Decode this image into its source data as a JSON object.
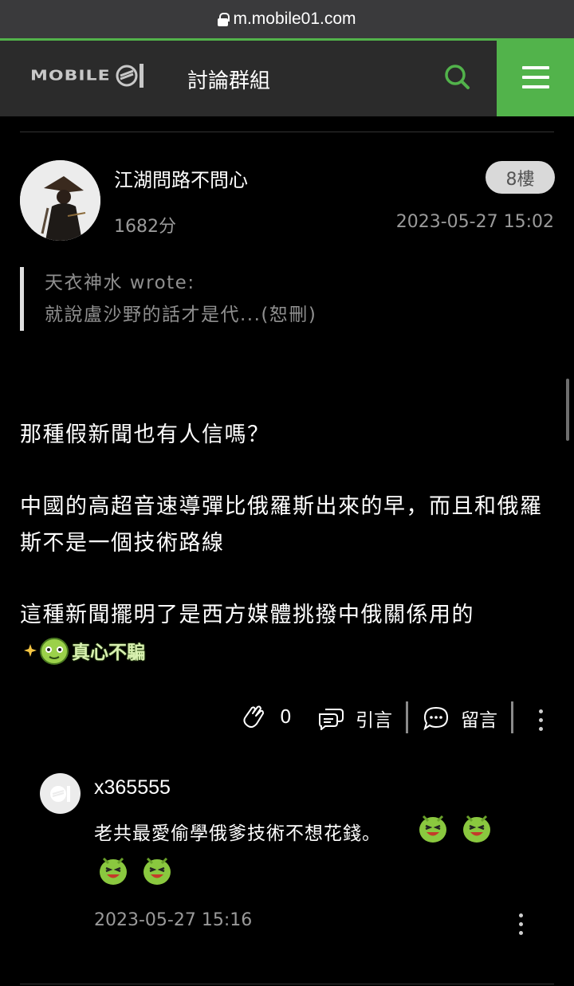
{
  "browser": {
    "url": "m.mobile01.com"
  },
  "header": {
    "logo_text": "MOBILE",
    "logo_suffix": "01",
    "section_title": "討論群組"
  },
  "post": {
    "author": "江湖問路不問心",
    "score": "1682分",
    "floor": "8樓",
    "time": "2023-05-27 15:02",
    "quote": {
      "line1": "天衣神水 wrote:",
      "line2": "就說盧沙野的話才是代...(恕刪)"
    },
    "paragraphs": [
      "那種假新聞也有人信嗎？",
      "中國的高超音速導彈比俄羅斯出來的早，而且和俄羅斯不是一個技術路線",
      "這種新聞擺明了是西方媒體挑撥中俄關係用的"
    ],
    "sticker_text": "真心不騙",
    "actions": {
      "like_count": "0",
      "quote_label": "引言",
      "reply_label": "留言"
    }
  },
  "comment": {
    "user": "x365555",
    "text": "老共最愛偷學俄爹技術不想花錢。",
    "time": "2023-05-27 15:16"
  },
  "colors": {
    "accent": "#52b34b",
    "header_bg": "#2b2b2b",
    "background": "#000000",
    "muted_text": "#9a9a9a"
  }
}
